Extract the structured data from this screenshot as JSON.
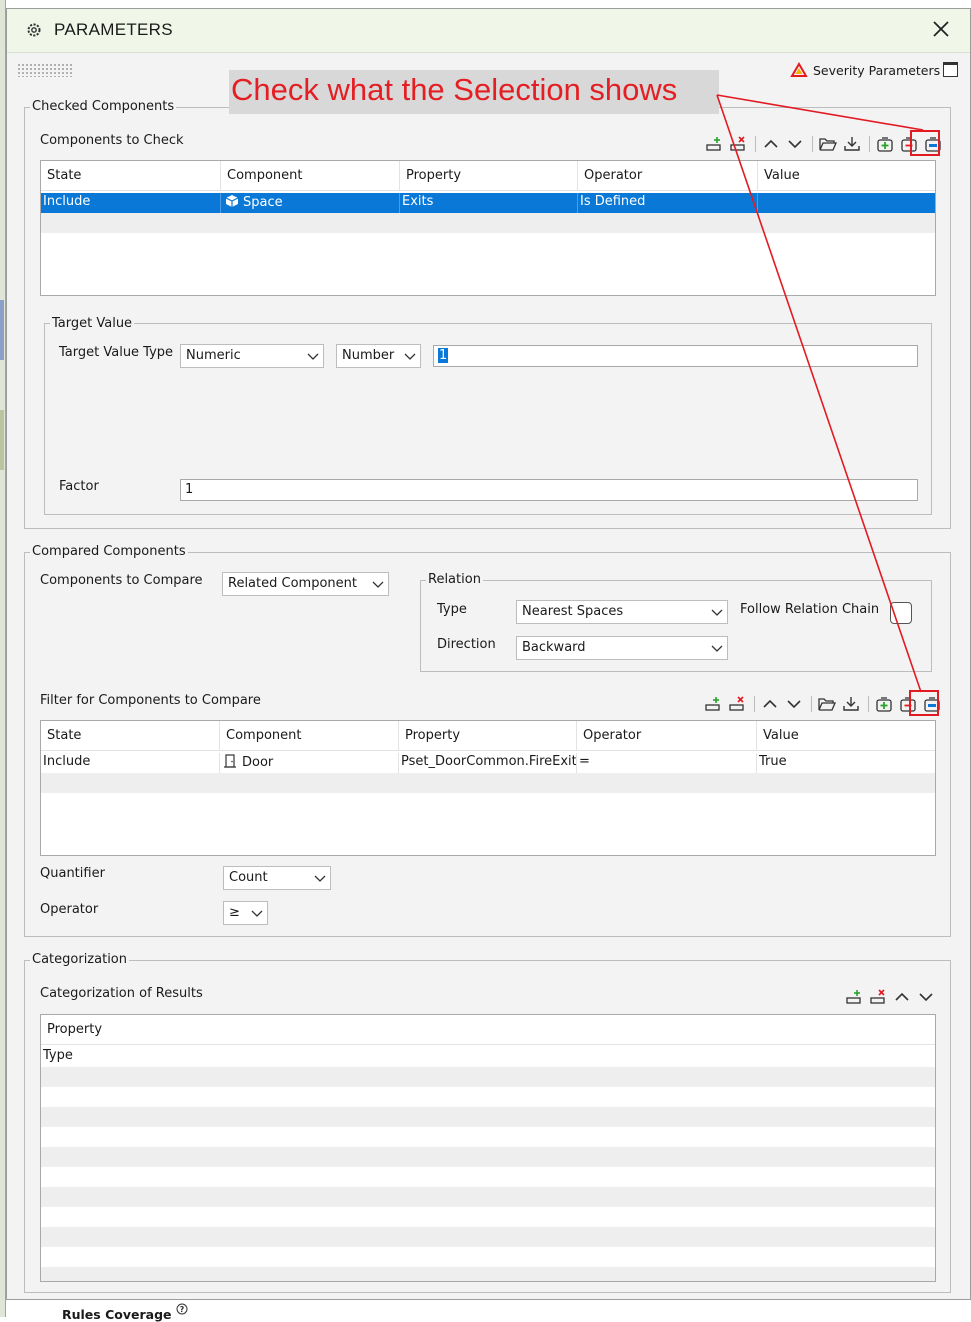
{
  "window": {
    "title": "PARAMETERS"
  },
  "severity": {
    "label": "Severity Parameters"
  },
  "callout": {
    "text": "Check what the Selection shows"
  },
  "checked": {
    "group_label": "Checked Components",
    "section_label": "Components to Check",
    "headers": [
      "State",
      "Component",
      "Property",
      "Operator",
      "Value"
    ],
    "rows": [
      {
        "state": "Include",
        "component": "Space",
        "property": "Exits",
        "operator": "Is Defined",
        "value": ""
      }
    ]
  },
  "target": {
    "group_label": "Target Value",
    "type_label": "Target Value Type",
    "type_value": "Numeric",
    "unit_value": "Number",
    "value": "1",
    "factor_label": "Factor",
    "factor_value": "1"
  },
  "compared": {
    "group_label": "Compared Components",
    "compare_label": "Components to Compare",
    "compare_value": "Related Component",
    "relation_label": "Relation",
    "type_label": "Type",
    "type_value": "Nearest Spaces",
    "follow_label": "Follow Relation Chain",
    "direction_label": "Direction",
    "direction_value": "Backward",
    "filter_label": "Filter for Components to Compare",
    "headers": [
      "State",
      "Component",
      "Property",
      "Operator",
      "Value"
    ],
    "rows": [
      {
        "state": "Include",
        "component": "Door",
        "property": "Pset_DoorCommon.FireExit",
        "operator": "=",
        "value": "True"
      }
    ],
    "quantifier_label": "Quantifier",
    "quantifier_value": "Count",
    "operator_label": "Operator",
    "operator_value": "≥"
  },
  "categorization": {
    "group_label": "Categorization",
    "section_label": "Categorization of Results",
    "header": "Property",
    "rows": [
      "Type"
    ]
  },
  "footer": {
    "label": "Rules Coverage"
  },
  "colors": {
    "selection": "#0a78d7",
    "annotation": "#e21b23",
    "titlebar": "#f0f7e8"
  }
}
